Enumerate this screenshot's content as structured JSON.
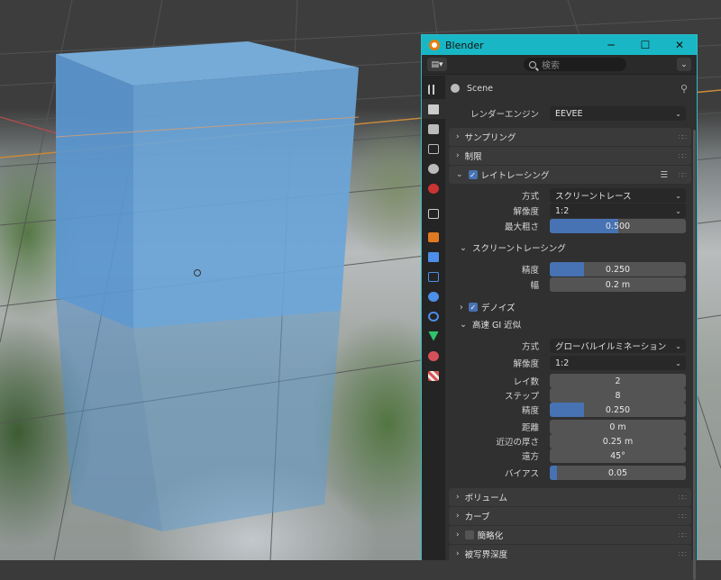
{
  "window": {
    "title": "Blender",
    "controls": [
      "─",
      "☐",
      "✕"
    ]
  },
  "toolbar": {
    "editor_icon": "editor-type-icon",
    "search_placeholder": "検索"
  },
  "context": {
    "scene": "Scene"
  },
  "sidebar_icons": [
    "tool-icon",
    "render-icon",
    "output-icon",
    "view-layer-icon",
    "scene-icon",
    "world-icon",
    "collection-icon",
    "object-icon",
    "modifier-icon",
    "particles-icon",
    "physics-icon",
    "constraints-icon",
    "data-icon",
    "material-icon",
    "texture-icon"
  ],
  "render": {
    "engine_label": "レンダーエンジン",
    "engine_value": "EEVEE",
    "panels": {
      "sampling": "サンプリング",
      "limits": "制限",
      "raytracing": "レイトレーシング"
    },
    "raytracing": {
      "method_label": "方式",
      "method_value": "スクリーントレース",
      "resolution_label": "解像度",
      "resolution_value": "1:2",
      "max_roughness_label": "最大粗さ",
      "max_roughness_value": "0.500",
      "max_roughness_fraction": 0.5,
      "screen_tracing": {
        "title": "スクリーントレーシング",
        "precision_label": "精度",
        "precision_value": "0.250",
        "precision_fraction": 0.25,
        "thickness_label": "幅",
        "thickness_value": "0.2 m"
      },
      "denoise": "デノイズ",
      "fast_gi": {
        "title": "高速 GI 近似",
        "method_label": "方式",
        "method_value": "グローバルイルミネーション",
        "resolution_label": "解像度",
        "resolution_value": "1:2",
        "ray_count_label": "レイ数",
        "ray_count_value": "2",
        "step_label": "ステップ",
        "step_value": "8",
        "precision_label": "精度",
        "precision_value": "0.250",
        "precision_fraction": 0.25,
        "distance_label": "距離",
        "distance_value": "0 m",
        "thickness_near_label": "近辺の厚さ",
        "thickness_near_value": "0.25 m",
        "thickness_far_label": "遠方",
        "thickness_far_value": "45°",
        "bias_label": "バイアス",
        "bias_value": "0.05",
        "bias_fraction": 0.05
      }
    },
    "more_panels": {
      "volumes": "ボリューム",
      "curves": "カーブ",
      "simplify": "簡略化",
      "dof": "被写界深度"
    }
  }
}
